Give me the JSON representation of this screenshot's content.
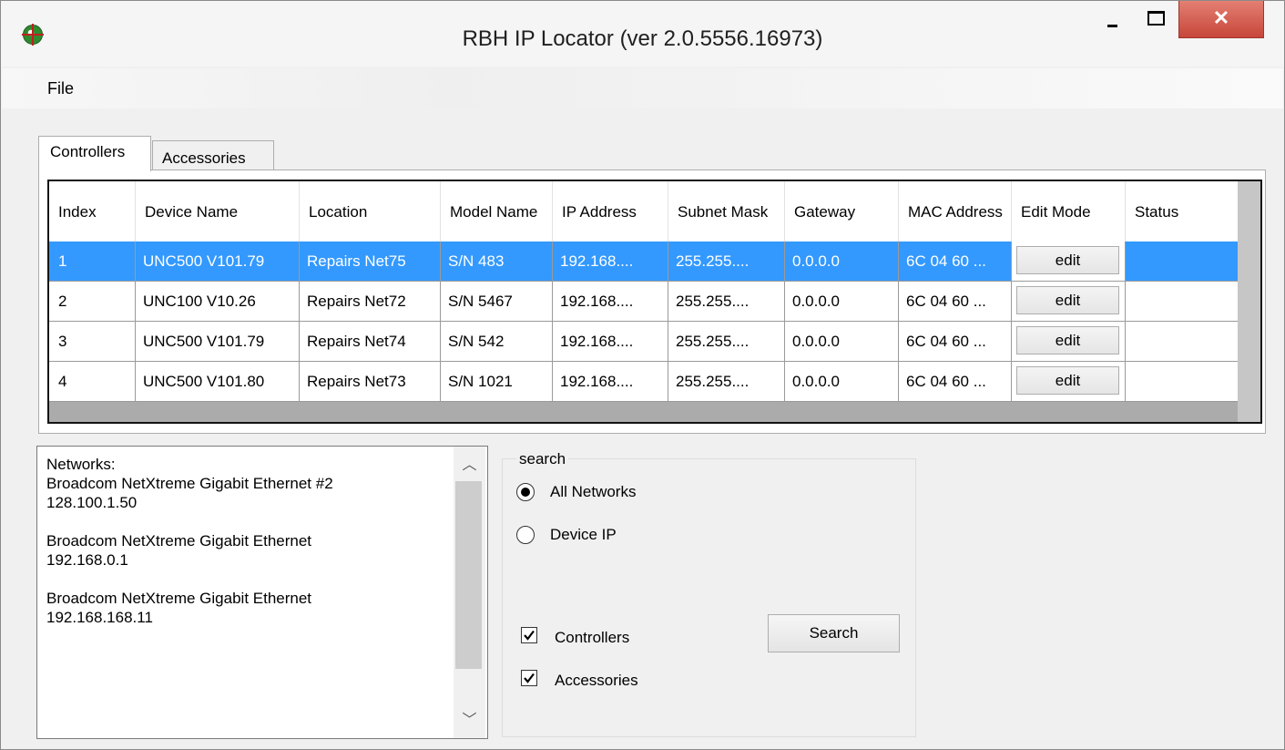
{
  "window": {
    "title": "RBH IP Locator (ver 2.0.5556.16973)",
    "close_glyph": "✕"
  },
  "menu": {
    "file": "File"
  },
  "tabs": [
    {
      "label": "Controllers",
      "active": true
    },
    {
      "label": "Accessories",
      "active": false
    }
  ],
  "grid": {
    "columns": [
      "Index",
      "Device Name",
      "Location",
      "Model Name",
      "IP Address",
      "Subnet Mask",
      "Gateway",
      "MAC Address",
      "Edit Mode",
      "Status"
    ],
    "rows": [
      {
        "index": "1",
        "device_name": "UNC500 V101.79",
        "location": "Repairs Net75",
        "model_name": "S/N 483",
        "ip": "192.168....",
        "subnet": "255.255....",
        "gateway": "0.0.0.0",
        "mac": "6C 04 60 ...",
        "edit": "edit",
        "status": "",
        "selected": true
      },
      {
        "index": "2",
        "device_name": "UNC100 V10.26",
        "location": "Repairs Net72",
        "model_name": "S/N 5467",
        "ip": "192.168....",
        "subnet": "255.255....",
        "gateway": "0.0.0.0",
        "mac": "6C 04 60 ...",
        "edit": "edit",
        "status": "",
        "selected": false
      },
      {
        "index": "3",
        "device_name": "UNC500 V101.79",
        "location": "Repairs Net74",
        "model_name": "S/N 542",
        "ip": "192.168....",
        "subnet": "255.255....",
        "gateway": "0.0.0.0",
        "mac": "6C 04 60 ...",
        "edit": "edit",
        "status": "",
        "selected": false
      },
      {
        "index": "4",
        "device_name": "UNC500 V101.80",
        "location": "Repairs Net73",
        "model_name": "S/N 1021",
        "ip": "192.168....",
        "subnet": "255.255....",
        "gateway": "0.0.0.0",
        "mac": "6C 04 60 ...",
        "edit": "edit",
        "status": "",
        "selected": false
      }
    ]
  },
  "networks": {
    "text": "Networks:\nBroadcom NetXtreme Gigabit Ethernet #2\n128.100.1.50\n\nBroadcom NetXtreme Gigabit Ethernet\n192.168.0.1\n\nBroadcom NetXtreme Gigabit Ethernet\n192.168.168.11"
  },
  "search": {
    "legend": "search",
    "radio_all": {
      "label": "All Networks",
      "checked": true
    },
    "radio_device": {
      "label": "Device IP",
      "checked": false
    },
    "check_controllers": {
      "label": "Controllers",
      "checked": true
    },
    "check_accessories": {
      "label": "Accessories",
      "checked": true
    },
    "button": "Search"
  },
  "colors": {
    "selection": "#3399ff",
    "close_button": "#c7463a",
    "window_bg": "#f0f0f0"
  }
}
